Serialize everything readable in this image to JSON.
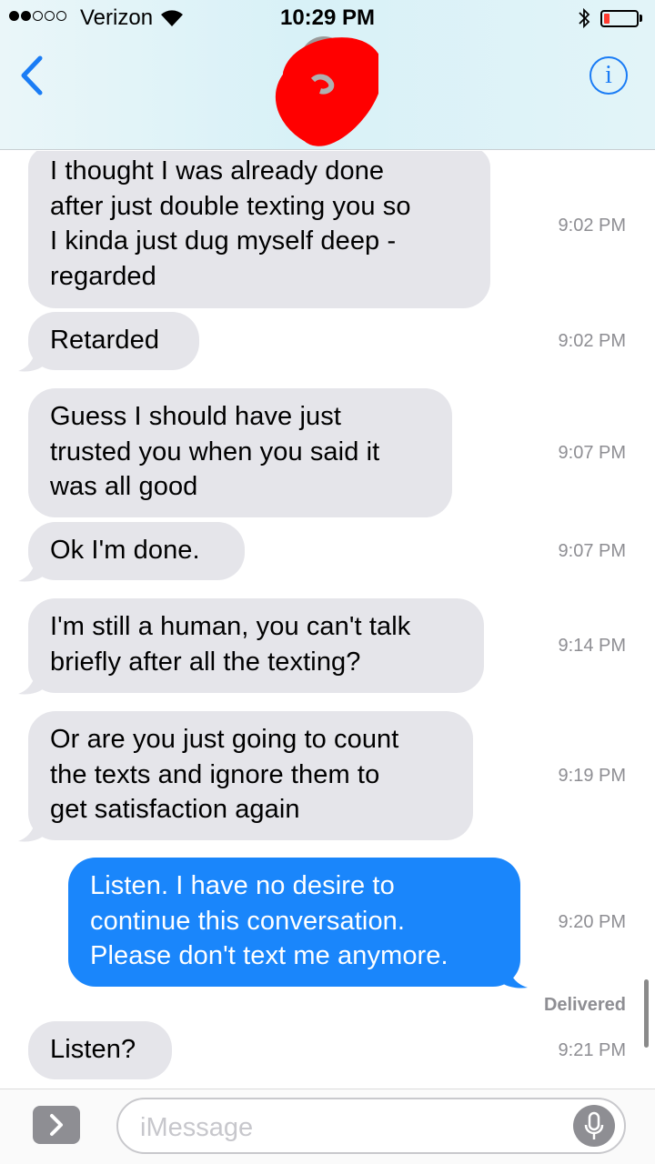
{
  "status_bar": {
    "carrier": "Verizon",
    "time": "10:29 PM",
    "signal_bars": 2,
    "signal_total": 5,
    "battery_level_percent": 10
  },
  "nav": {
    "back_icon": "chevron-left-icon",
    "info_label": "i",
    "contact": "avatar (scribbled out in red)"
  },
  "messages": [
    {
      "direction": "incoming",
      "lines": [
        "I thought I was already done",
        "after just double texting you so",
        "I kinda just dug myself deep -",
        "regarded"
      ],
      "time": "9:02 PM"
    },
    {
      "direction": "incoming",
      "lines": [
        "Retarded"
      ],
      "time": "9:02 PM"
    },
    {
      "direction": "incoming",
      "lines": [
        "Guess I should have just",
        "trusted you when you said it",
        "was all good"
      ],
      "time": "9:07 PM"
    },
    {
      "direction": "incoming",
      "lines": [
        "Ok I'm done."
      ],
      "time": "9:07 PM"
    },
    {
      "direction": "incoming",
      "lines": [
        "I'm still a human, you can't talk",
        "briefly after all the texting?"
      ],
      "time": "9:14 PM"
    },
    {
      "direction": "incoming",
      "lines": [
        "Or are you just going to count",
        "the texts and ignore them to",
        "get satisfaction again"
      ],
      "time": "9:19 PM"
    },
    {
      "direction": "outgoing",
      "lines": [
        "Listen. I have no desire to",
        "continue this conversation.",
        "Please don't text me anymore."
      ],
      "time": "9:20 PM"
    },
    {
      "direction": "incoming",
      "lines": [
        "Listen?"
      ],
      "time": "9:21 PM"
    }
  ],
  "delivered_label": "Delivered",
  "input": {
    "placeholder": "iMessage",
    "apps_icon": "chevron-right-icon",
    "mic_icon": "microphone-icon"
  },
  "colors": {
    "incoming_bubble": "#e5e5ea",
    "outgoing_bubble": "#1a86fb",
    "accent": "#1a7cf5",
    "timestamp": "#8e8e93"
  }
}
